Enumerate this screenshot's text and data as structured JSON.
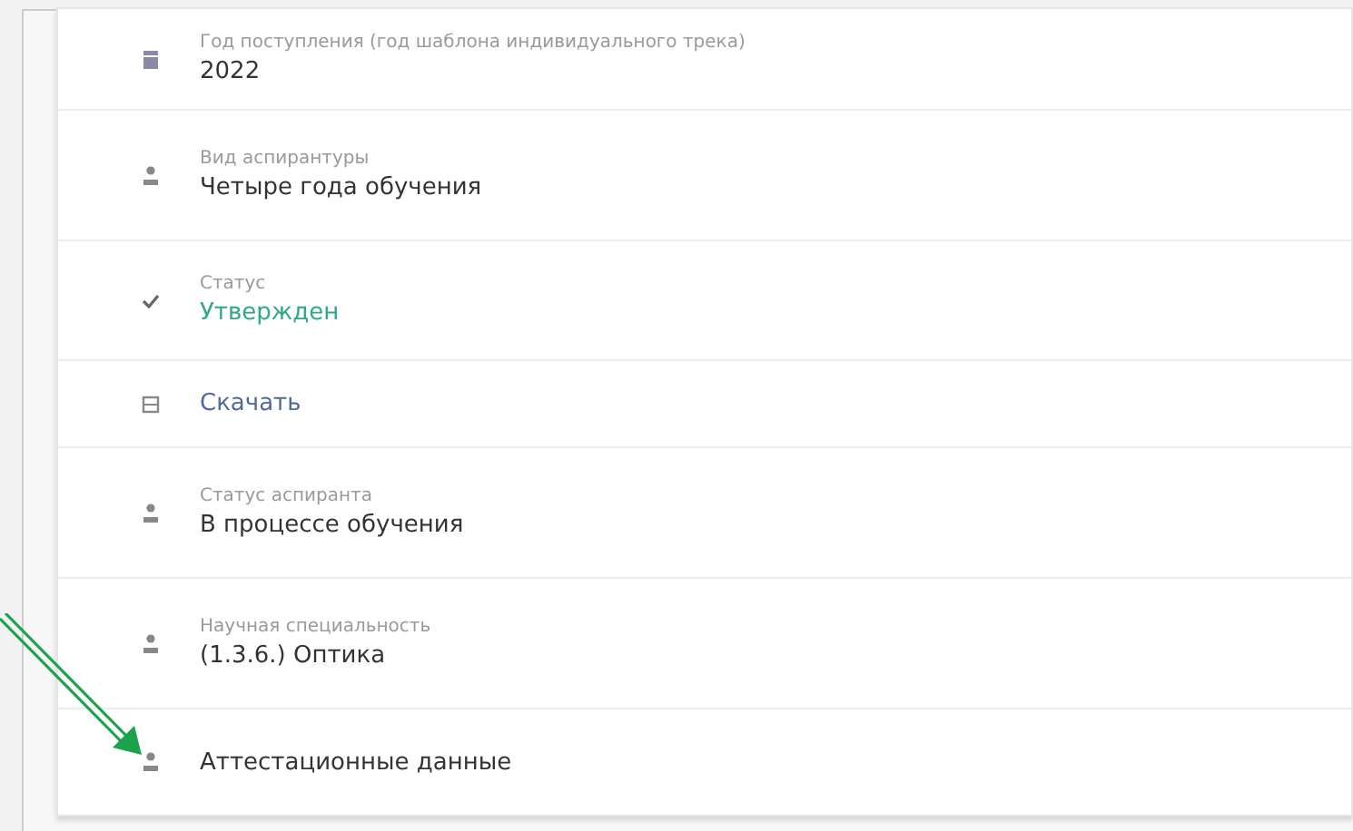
{
  "rows": [
    {
      "kind": "field",
      "label": "Год поступления (год шаблона индивидуального трека)",
      "value": "2022"
    },
    {
      "kind": "field",
      "label": "Вид аспирантуры",
      "value": "Четыре года обучения"
    },
    {
      "kind": "status",
      "label": "Статус",
      "value": "Утвержден"
    },
    {
      "kind": "link",
      "value": "Скачать"
    },
    {
      "kind": "field",
      "label": "Статус аспиранта",
      "value": "В процессе обучения"
    },
    {
      "kind": "field",
      "label": "Научная специальность",
      "value": "(1.3.6.) Оптика"
    },
    {
      "kind": "plain",
      "value": "Аттестационные данные"
    }
  ]
}
